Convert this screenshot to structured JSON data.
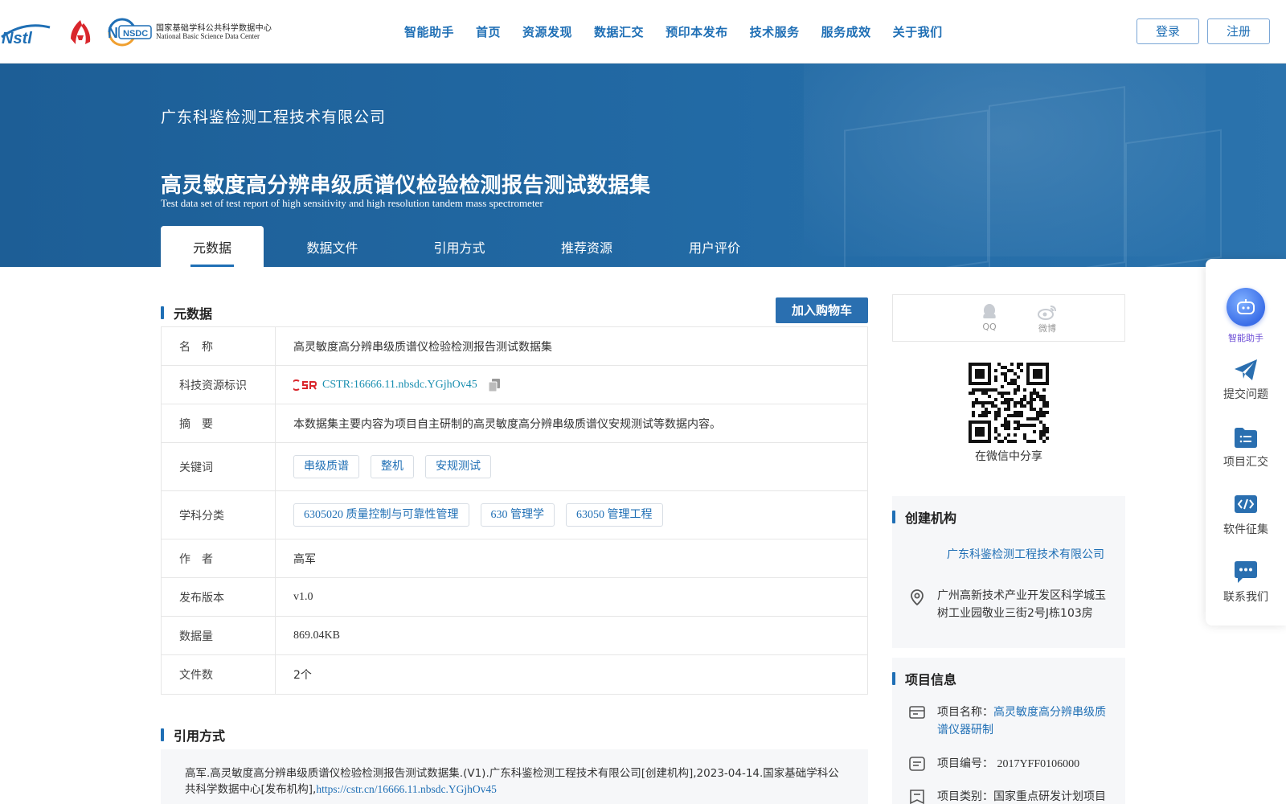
{
  "logos": {
    "nstl": "Nstl",
    "cas": "CAS",
    "nsdc_badge": "NSDC",
    "nsdc_cn": "国家基础学科公共科学数据中心",
    "nsdc_en": "National Basic Science Data Center"
  },
  "nav": {
    "items": [
      "智能助手",
      "首页",
      "资源发现",
      "数据汇交",
      "预印本发布",
      "技术服务",
      "服务成效",
      "关于我们"
    ],
    "login": "登录",
    "register": "注册"
  },
  "banner": {
    "org": "广东科鉴检测工程技术有限公司",
    "title": "高灵敏度高分辨串级质谱仪检验检测报告测试数据集",
    "subtitle": "Test data set of test report of high sensitivity and high resolution tandem mass spectrometer",
    "tabs": [
      "元数据",
      "数据文件",
      "引用方式",
      "推荐资源",
      "用户评价"
    ]
  },
  "metadata": {
    "section_title": "元数据",
    "cart_button": "加入购物车",
    "rows": {
      "name": {
        "label": "名　称",
        "value": "高灵敏度高分辨串级质谱仪检验检测报告测试数据集"
      },
      "cstr": {
        "label": "科技资源标识",
        "value": "CSTR:16666.11.nbsdc.YGjhOv45"
      },
      "abstract": {
        "label": "摘　要",
        "value": "本数据集主要内容为项目自主研制的高灵敏度高分辨串级质谱仪安规测试等数据内容。"
      },
      "keywords": {
        "label": "关键词",
        "values": [
          "串级质谱",
          "整机",
          "安规测试"
        ]
      },
      "subjects": {
        "label": "学科分类",
        "values": [
          "6305020 质量控制与可靠性管理",
          "630 管理学",
          "63050 管理工程"
        ]
      },
      "author": {
        "label": "作　者",
        "value": "高军"
      },
      "version": {
        "label": "发布版本",
        "value": "v1.0"
      },
      "size": {
        "label": "数据量",
        "value": "869.04KB"
      },
      "files": {
        "label": "文件数",
        "value": "2个"
      }
    }
  },
  "citation": {
    "section_title": "引用方式",
    "text": "高军.高灵敏度高分辨串级质谱仪检验检测报告测试数据集.(V1).广东科鉴检测工程技术有限公司[创建机构],2023-04-14.国家基础学科公共科学数据中心[发布机构],",
    "link": "https://cstr.cn/16666.11.nbsdc.YGjhOv45"
  },
  "share": {
    "qq": "QQ",
    "weibo": "微博",
    "wechat_label": "在微信中分享"
  },
  "creator": {
    "section_title": "创建机构",
    "name": "广东科鉴检测工程技术有限公司",
    "address": "广州高新技术产业开发区科学城玉树工业园敬业三街2号J栋103房"
  },
  "project": {
    "section_title": "项目信息",
    "name_label": "项目名称：",
    "name_value": "高灵敏度高分辨串级质谱仪器研制",
    "code_label": "项目编号：",
    "code_value": "2017YFF0106000",
    "type_label": "项目类别：",
    "type_value": "国家重点研发计划项目"
  },
  "float_bar": {
    "items": [
      "智能助手",
      "提交问题",
      "项目汇交",
      "软件征集",
      "联系我们"
    ]
  },
  "colors": {
    "brand": "#1f6fb5",
    "banner": "#226aa5",
    "link_teal": "#1a8fb0",
    "panel_bg": "#f6f7f9"
  }
}
